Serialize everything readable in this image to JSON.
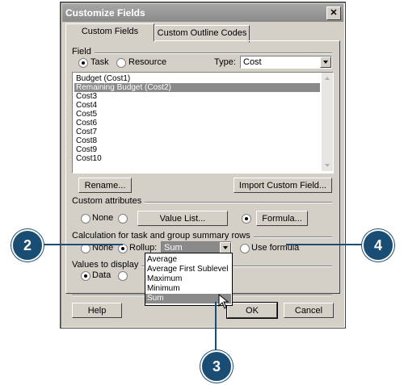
{
  "dialog": {
    "title": "Customize Fields",
    "close_glyph": "✕",
    "tabs": [
      {
        "label": "Custom Fields"
      },
      {
        "label": "Custom Outline Codes"
      }
    ],
    "field_group": {
      "label": "Field",
      "radio_task": "Task",
      "radio_resource": "Resource",
      "type_label": "Type:",
      "type_value": "Cost"
    },
    "field_list": [
      "Budget (Cost1)",
      "Remaining Budget (Cost2)",
      "Cost3",
      "Cost4",
      "Cost5",
      "Cost6",
      "Cost7",
      "Cost8",
      "Cost9",
      "Cost10"
    ],
    "selected_index": 1,
    "rename_button": "Rename...",
    "import_button": "Import Custom Field...",
    "custom_attributes": {
      "label": "Custom attributes",
      "none_label": "None",
      "value_list_button": "Value List...",
      "formula_button": "Formula..."
    },
    "calculation": {
      "label": "Calculation for task and group summary rows",
      "none_label": "None",
      "rollup_label": "Rollup:",
      "rollup_value": "Sum",
      "use_formula_label": "Use formula"
    },
    "rollup_options": [
      "Average",
      "Average First Sublevel",
      "Maximum",
      "Minimum",
      "Sum"
    ],
    "rollup_selected": "Sum",
    "values_to_display": {
      "label": "Values to display",
      "data_label": "Data"
    },
    "help_button": "Help",
    "ok_button": "OK",
    "cancel_button": "Cancel"
  },
  "callouts": [
    "2",
    "3",
    "4"
  ],
  "colors": {
    "callout": "#1a4d73",
    "dialog": "#d4d0c8",
    "selection": "#8a8a8a"
  }
}
